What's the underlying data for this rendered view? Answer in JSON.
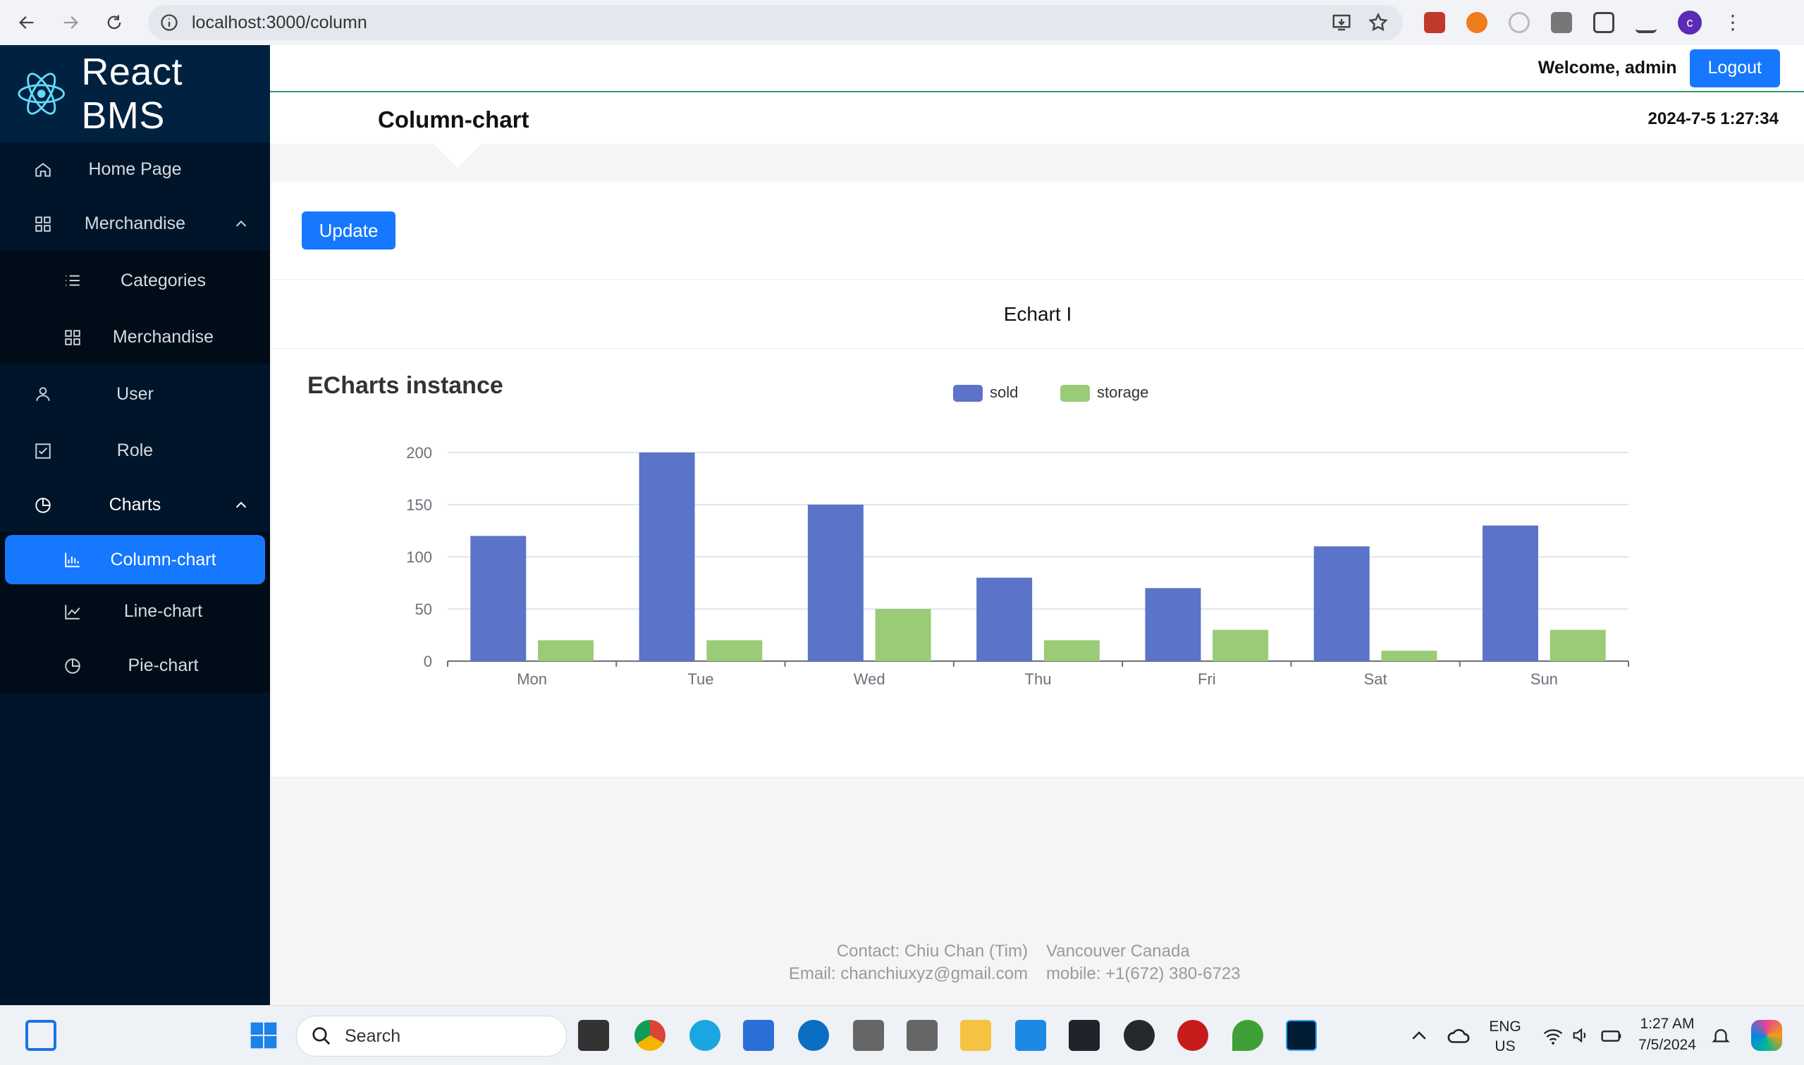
{
  "browser": {
    "url": "localhost:3000/column"
  },
  "sidebar": {
    "app_title": "React BMS",
    "items": [
      {
        "label": "Home Page"
      },
      {
        "label": "Merchandise"
      },
      {
        "label": "Categories"
      },
      {
        "label": "Merchandise"
      },
      {
        "label": "User"
      },
      {
        "label": "Role"
      },
      {
        "label": "Charts"
      },
      {
        "label": "Column-chart"
      },
      {
        "label": "Line-chart"
      },
      {
        "label": "Pie-chart"
      }
    ]
  },
  "header": {
    "welcome": "Welcome, admin",
    "logout_label": "Logout",
    "page_title": "Column-chart",
    "datetime": "2024-7-5 1:27:34"
  },
  "main": {
    "update_label": "Update",
    "card_title": "Echart I"
  },
  "chart_data": {
    "type": "bar",
    "title": "ECharts instance",
    "categories": [
      "Mon",
      "Tue",
      "Wed",
      "Thu",
      "Fri",
      "Sat",
      "Sun"
    ],
    "series": [
      {
        "name": "sold",
        "values": [
          120,
          200,
          150,
          80,
          70,
          110,
          130
        ],
        "color": "#5b73c8"
      },
      {
        "name": "storage",
        "values": [
          20,
          20,
          50,
          20,
          30,
          10,
          30
        ],
        "color": "#9acb77"
      }
    ],
    "yticks": [
      "0",
      "50",
      "100",
      "150",
      "200"
    ],
    "ylim": [
      0,
      200
    ],
    "grid": true,
    "legend": "top-center"
  },
  "footer": {
    "contact": "Contact: Chiu Chan (Tim)",
    "location": "Vancouver Canada",
    "email": "Email: chanchiuxyz@gmail.com",
    "mobile": "mobile: +1(672) 380-6723"
  },
  "taskbar": {
    "search_placeholder": "Search",
    "lang_top": "ENG",
    "lang_bottom": "US",
    "time": "1:27 AM",
    "date": "7/5/2024"
  },
  "colors": {
    "sidebar_bg": "#001529",
    "accent": "#1677ff",
    "header_line": "#2e9d6a"
  }
}
